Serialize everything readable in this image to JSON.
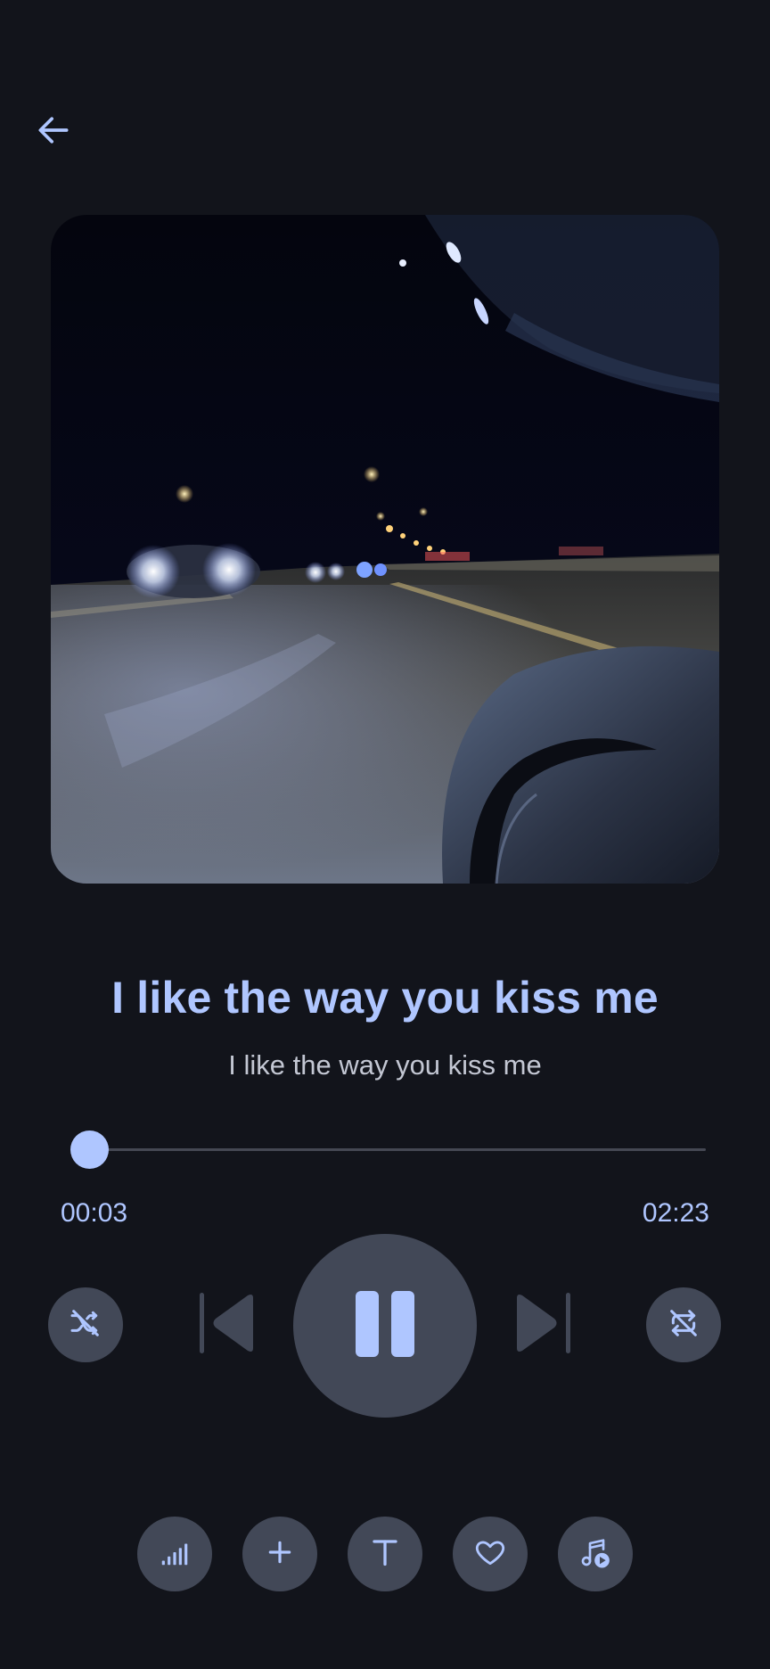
{
  "song": {
    "title": "I like the way you kiss me",
    "subtitle": "I like the way you kiss me"
  },
  "playback": {
    "elapsed": "00:03",
    "total": "02:23",
    "progress_fraction": 0.021,
    "state": "playing"
  },
  "icons": {
    "back": "arrow-left-icon",
    "shuffle": "shuffle-off-icon",
    "previous": "skip-previous-icon",
    "pause": "pause-icon",
    "next": "skip-next-icon",
    "repeat": "repeat-off-icon",
    "equalizer": "signal-bars-icon",
    "add": "plus-icon",
    "lyrics": "text-icon",
    "favorite": "heart-icon",
    "queue": "music-play-icon"
  },
  "colors": {
    "background": "#12141b",
    "accent": "#afc6ff",
    "button_bg": "#424857",
    "subtitle_text": "#c3c7d3",
    "track": "#454853"
  }
}
